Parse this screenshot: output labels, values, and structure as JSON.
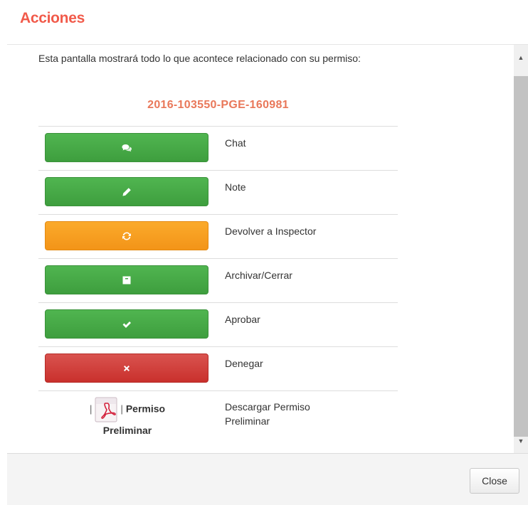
{
  "modal": {
    "title": "Acciones",
    "intro_text": "Esta pantalla mostrará todo lo que acontece relacionado con su permiso:",
    "permit_id": "2016-103550-PGE-160981",
    "actions": [
      {
        "label": "Chat",
        "icon": "comments-icon",
        "color": "#45a845"
      },
      {
        "label": "Note",
        "icon": "pencil-icon",
        "color": "#45a845"
      },
      {
        "label": "Devolver a Inspector",
        "icon": "refresh-icon",
        "color": "#f7a020"
      },
      {
        "label": "Archivar/Cerrar",
        "icon": "archive-icon",
        "color": "#45a845"
      },
      {
        "label": "Aprobar",
        "icon": "check-icon",
        "color": "#45a845"
      },
      {
        "label": "Denegar",
        "icon": "times-icon",
        "color": "#d0433f"
      }
    ],
    "download": {
      "separator_left": "|",
      "separator_right": "|",
      "link_line1": "Permiso",
      "link_line2": "Preliminar",
      "label": "Descargar Permiso Preliminar",
      "icon": "pdf-icon"
    },
    "footer": {
      "close_label": "Close"
    }
  }
}
